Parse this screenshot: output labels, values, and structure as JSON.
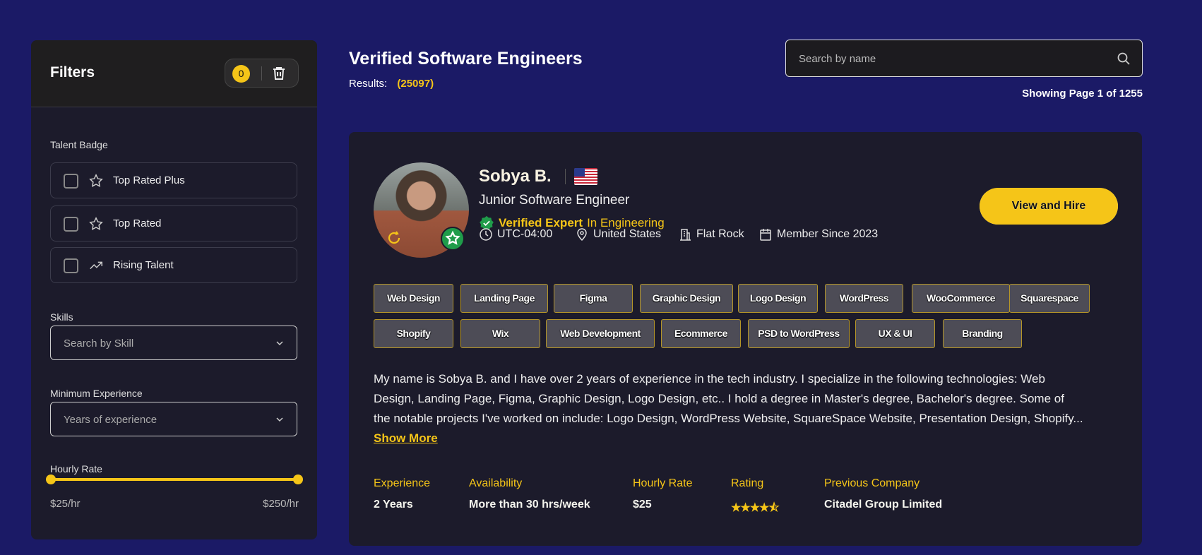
{
  "colors": {
    "background": "#1b1a66",
    "panel": "#1c1b2b",
    "accent": "#f5c518",
    "verified": "#1f9c4a"
  },
  "sidebar": {
    "title": "Filters",
    "filter_count": "0",
    "talent_badge_label": "Talent Badge",
    "badges": [
      {
        "label": "Top Rated Plus",
        "icon": "star-icon"
      },
      {
        "label": "Top Rated",
        "icon": "star-icon"
      },
      {
        "label": "Rising Talent",
        "icon": "trending-up-icon"
      }
    ],
    "skills_label": "Skills",
    "skills_placeholder": "Search by Skill",
    "experience_label": "Minimum Experience",
    "experience_placeholder": "Years of experience",
    "rate_label": "Hourly Rate",
    "rate_min": "$25/hr",
    "rate_max": "$250/hr"
  },
  "header": {
    "title": "Verified Software Engineers",
    "results_label": "Results:",
    "results_count": "(25097)",
    "search_placeholder": "Search by name",
    "paging_prefix": "Showing Page ",
    "page": "1",
    "paging_mid": " of ",
    "total_pages": "1255"
  },
  "profile": {
    "name": "Sobya B.",
    "country_flag": "us-flag",
    "role": "Junior Software Engineer",
    "verified": "Verified Expert",
    "verified_field": "In Engineering",
    "timezone": "UTC-04:00",
    "country": "United States",
    "city": "Flat Rock",
    "member_since": "Member Since 2023",
    "hire_button": "View and Hire",
    "skills": [
      "Web Design",
      "Landing Page",
      "Figma",
      "Graphic Design",
      "Logo Design",
      "WordPress",
      "WooCommerce",
      "Squarespace",
      "Shopify",
      "Wix",
      "Web Development",
      "Ecommerce",
      "PSD to WordPress",
      "UX & UI",
      "Branding"
    ],
    "bio_lines": [
      "My name is Sobya B. and I have over 2 years of experience in the tech industry. I specialize in the following technologies: Web",
      "Design, Landing Page, Figma, Graphic Design, Logo Design, etc.. I hold a degree in Master's degree, Bachelor's degree. Some of",
      "the notable projects I've worked on include: Logo Design, WordPress Website, SquareSpace Website, Presentation Design, Shopify..."
    ],
    "show_more": "Show More",
    "stats": {
      "experience_label": "Experience",
      "experience": "2 Years",
      "availability_label": "Availability",
      "availability": "More than 30 hrs/week",
      "rate_label": "Hourly Rate",
      "rate": "$25",
      "rating_label": "Rating",
      "rating": 4.5,
      "company_label": "Previous Company",
      "company": "Citadel Group Limited"
    }
  }
}
